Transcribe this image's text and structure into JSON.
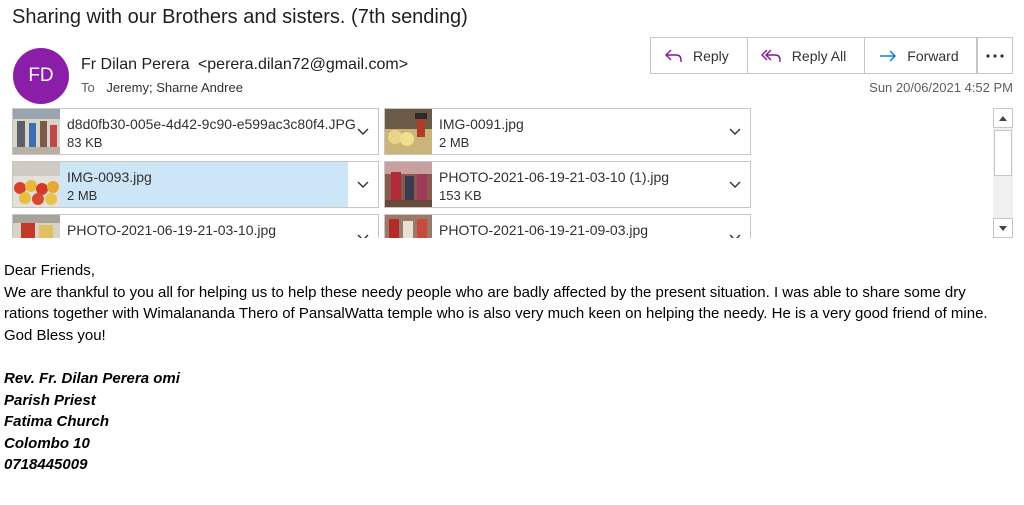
{
  "email": {
    "subject": "Sharing with our Brothers and sisters. (7th sending)",
    "avatar_initials": "FD",
    "avatar_color": "#8b1ea8",
    "sender_name": "Fr Dilan Perera",
    "sender_email": "<perera.dilan72@gmail.com>",
    "to_label": "To",
    "to_names": "Jeremy; Sharne Andree",
    "date": "Sun 20/06/2021 4:52 PM"
  },
  "actions": {
    "reply": "Reply",
    "reply_all": "Reply All",
    "forward": "Forward",
    "more": "•••"
  },
  "attachments": [
    {
      "name": "d8d0fb30-005e-4d42-9c90-e599ac3c80f4.JPG",
      "size": "83 KB",
      "selected": false
    },
    {
      "name": "IMG-0091.jpg",
      "size": "2 MB",
      "selected": false
    },
    {
      "name": "IMG-0093.jpg",
      "size": "2 MB",
      "selected": true
    },
    {
      "name": "PHOTO-2021-06-19-21-03-10 (1).jpg",
      "size": "153 KB",
      "selected": false
    },
    {
      "name": "PHOTO-2021-06-19-21-03-10.jpg",
      "size": "",
      "selected": false
    },
    {
      "name": "PHOTO-2021-06-19-21-09-03.jpg",
      "size": "",
      "selected": false
    }
  ],
  "body": {
    "greeting": "Dear Friends,",
    "paragraph": "We are thankful to you all for helping us to help these needy people who are badly affected by the present situation. I was able to share some dry rations together with Wimalananda Thero of PansalWatta temple who is also very much keen on helping the needy. He is a very good friend of mine.",
    "closing": "God Bless you!",
    "signature": {
      "name": "Rev. Fr. Dilan Perera omi",
      "title": "Parish Priest",
      "church": "Fatima Church",
      "city": "Colombo 10",
      "phone": "0718445009"
    }
  },
  "colors": {
    "accent": "#0078d4",
    "reply_all_icon": "#881798",
    "selected_attachment": "#cde6f7"
  }
}
